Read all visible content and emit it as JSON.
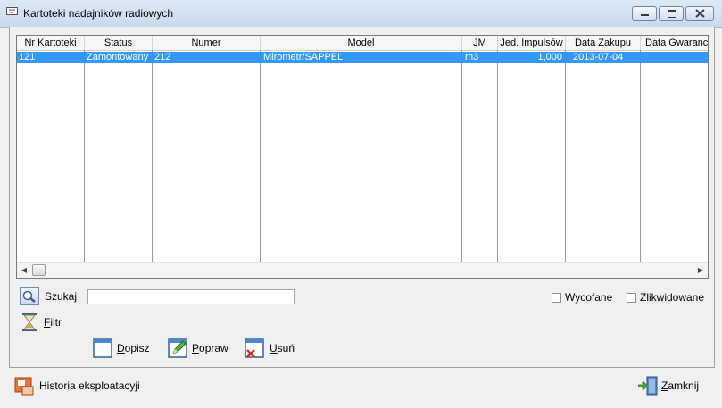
{
  "window": {
    "title": "Kartoteki nadajników radiowych"
  },
  "grid": {
    "columns": [
      "Nr Kartoteki",
      "Status",
      "Numer",
      "Model",
      "JM",
      "Jed. Impulsów",
      "Data Zakupu",
      "Data Gwaranc"
    ],
    "rows": [
      {
        "nr": "121",
        "status": "Zamontowany",
        "numer": "212",
        "model": "Mirometr/SAPPEL",
        "jm": "m3",
        "jed": "1,000",
        "data_zakupu": "2013-07-04",
        "data_gwar": ""
      }
    ]
  },
  "search": {
    "label": "Szukaj",
    "value": ""
  },
  "filter": {
    "label": "Filtr"
  },
  "checkboxes": {
    "wycofane": "Wycofane",
    "zlikwidowane": "Zlikwidowane"
  },
  "actions": {
    "dopisz": "Dopisz",
    "popraw": "Popraw",
    "usun": "Usuń"
  },
  "footer": {
    "historia": "Historia eksploatacyji",
    "zamknij": "Zamknij"
  },
  "colors": {
    "selection": "#3399ff",
    "titlebar": "#dfe9f5"
  }
}
